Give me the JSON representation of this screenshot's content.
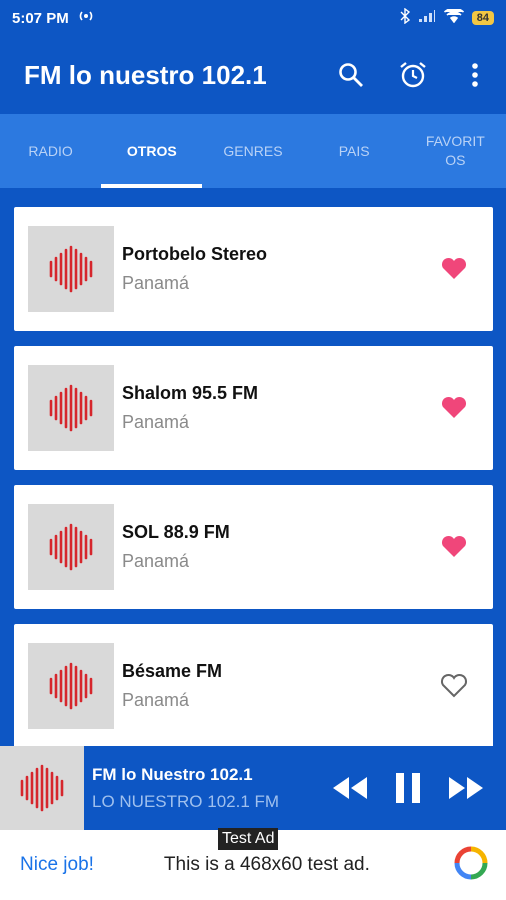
{
  "status": {
    "time": "5:07 PM",
    "battery": "84"
  },
  "appbar": {
    "title": "FM lo nuestro 102.1"
  },
  "tabs": [
    {
      "label": "RADIO",
      "active": false
    },
    {
      "label": "OTROS",
      "active": true
    },
    {
      "label": "GENRES",
      "active": false
    },
    {
      "label": "PAIS",
      "active": false
    },
    {
      "label": "FAVORIT\nOS",
      "active": false
    }
  ],
  "stations": [
    {
      "name": "Portobelo Stereo",
      "country": "Panamá",
      "favorite": true
    },
    {
      "name": "Shalom 95.5 FM",
      "country": "Panamá",
      "favorite": true
    },
    {
      "name": "SOL 88.9 FM",
      "country": "Panamá",
      "favorite": true
    },
    {
      "name": "Bésame FM",
      "country": "Panamá",
      "favorite": false
    }
  ],
  "player": {
    "title": "FM lo Nuestro 102.1",
    "subtitle": "LO NUESTRO 102.1 FM"
  },
  "ad": {
    "label": "Test Ad",
    "nice": "Nice job!",
    "text": "This is a 468x60 test ad."
  },
  "colors": {
    "primary": "#0d56c4",
    "tabbar": "#2c79e0",
    "heart": "#f0467a",
    "waveform": "#d6262c"
  }
}
